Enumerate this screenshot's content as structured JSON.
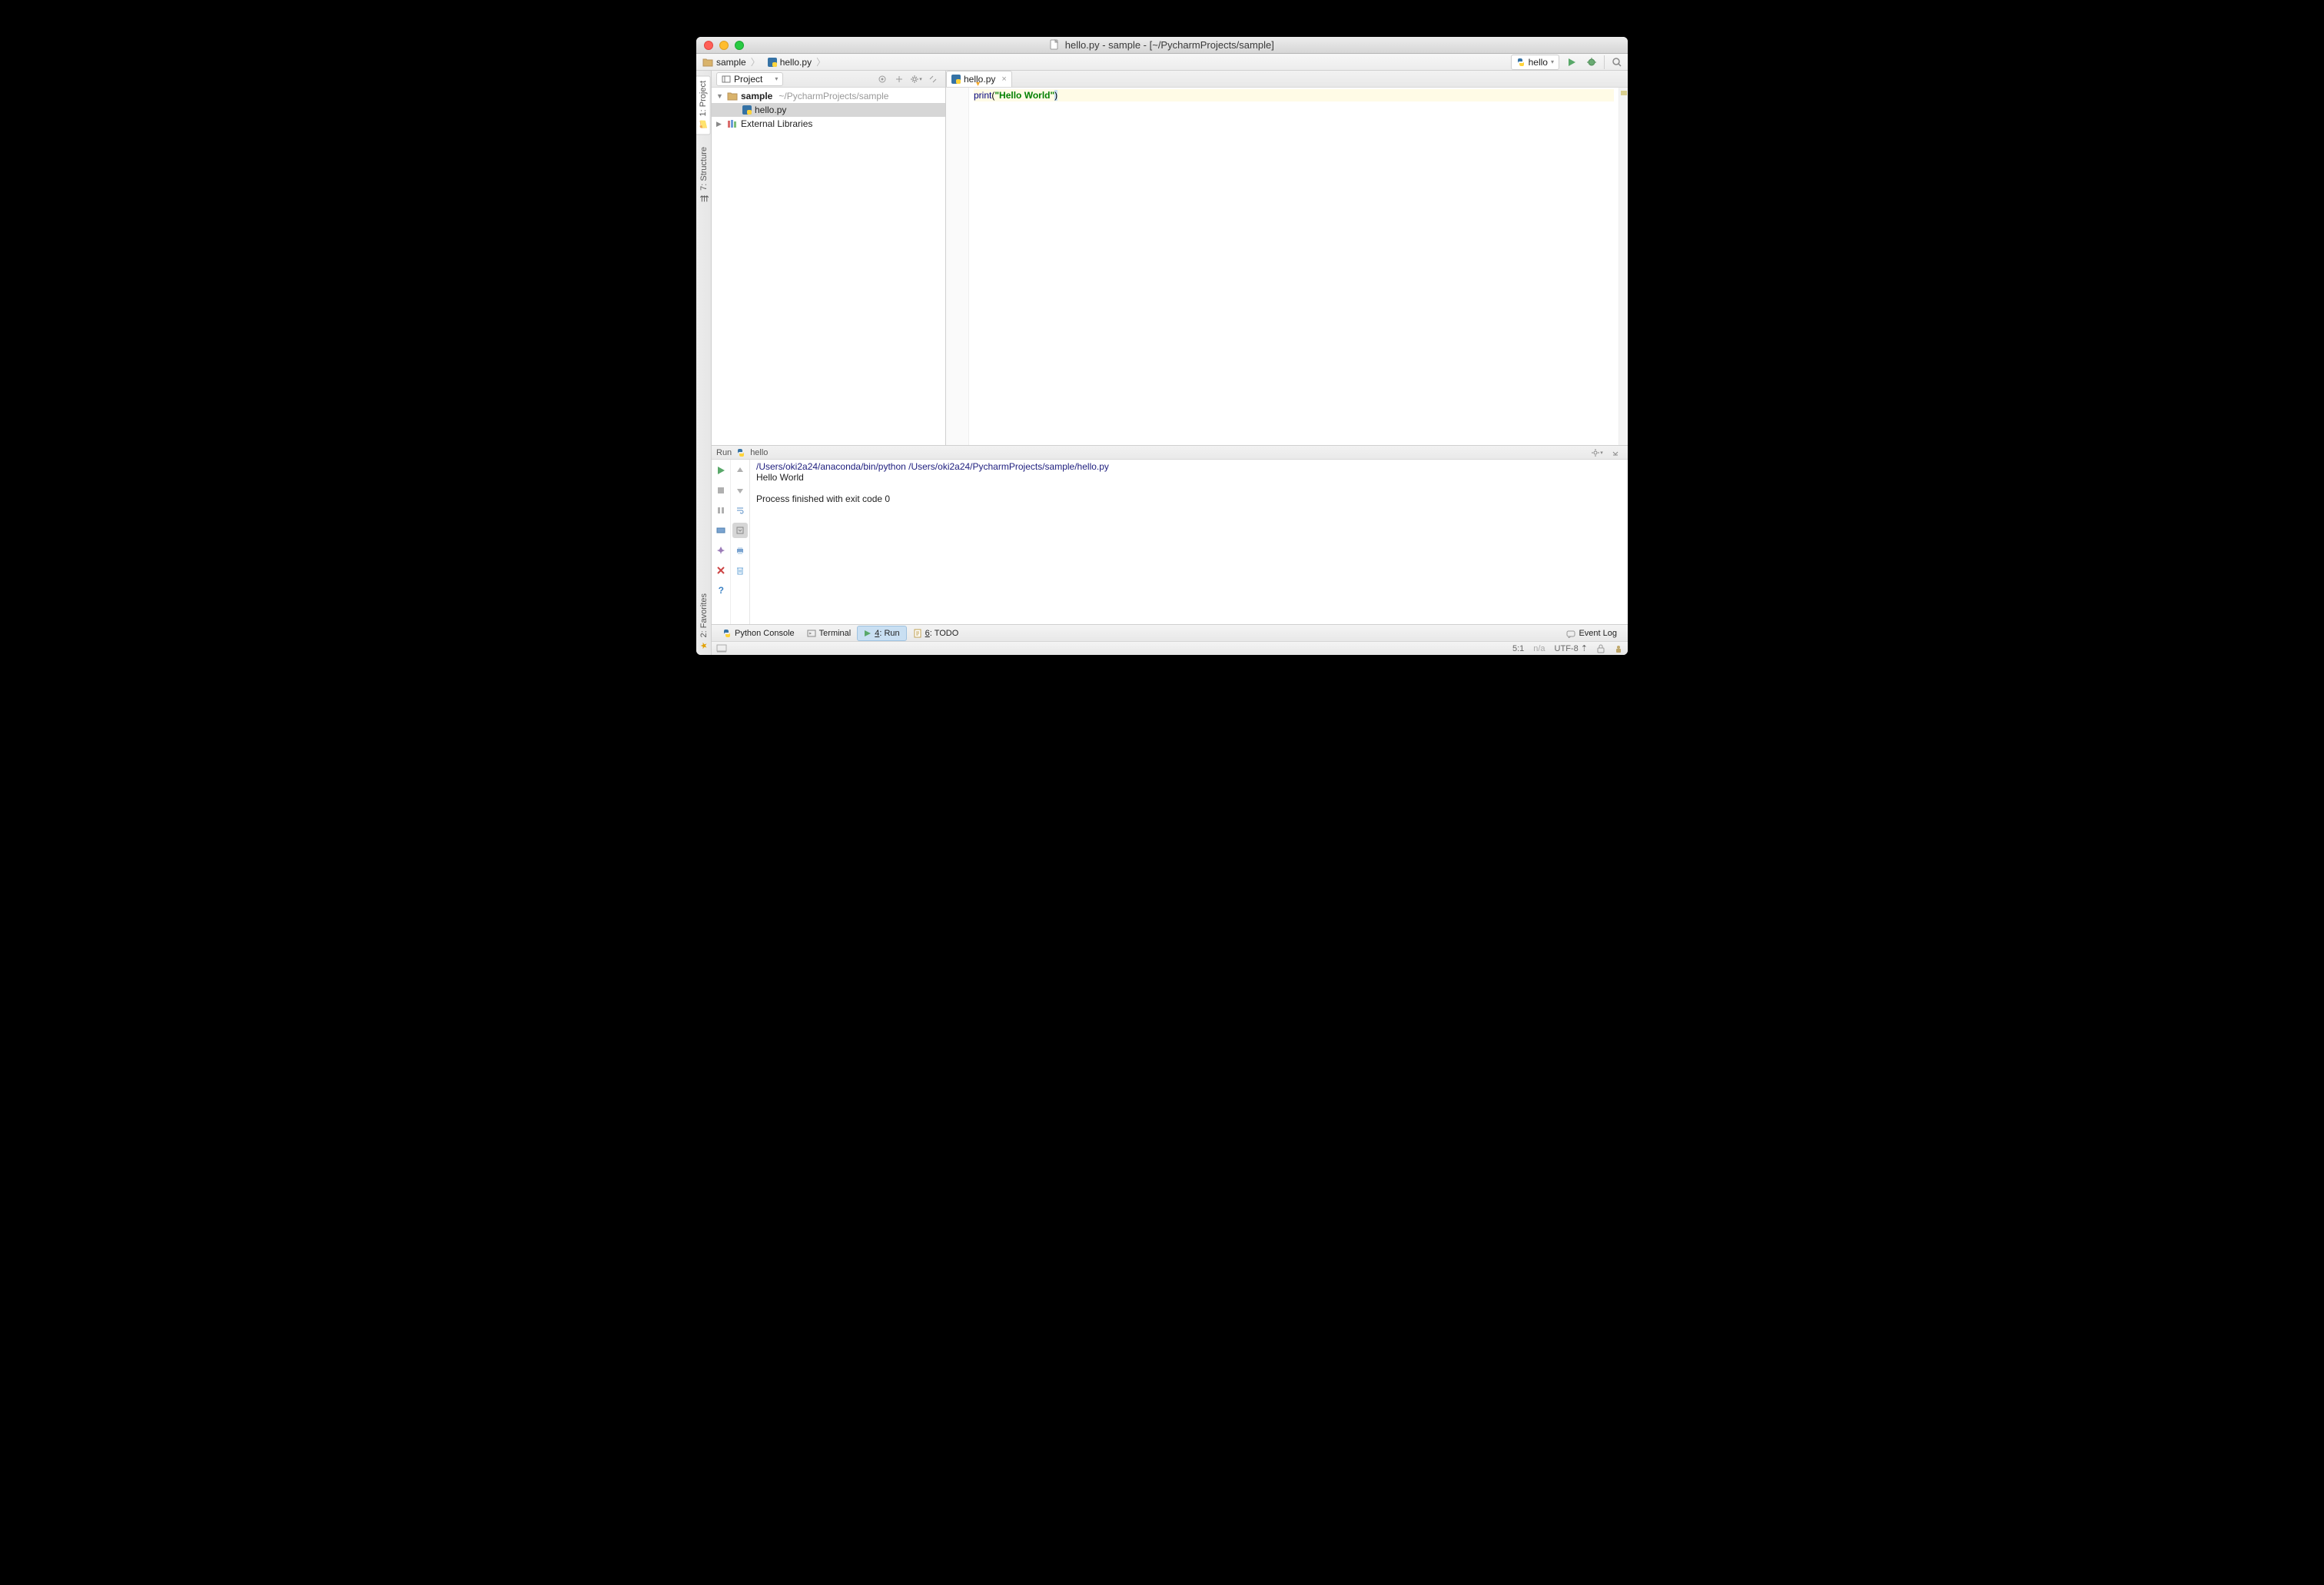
{
  "window": {
    "title": "hello.py - sample - [~/PycharmProjects/sample]"
  },
  "breadcrumbs": [
    {
      "icon": "folder",
      "label": "sample"
    },
    {
      "icon": "pyfile",
      "label": "hello.py"
    }
  ],
  "run_config": {
    "icon": "python",
    "label": "hello"
  },
  "sidebar": {
    "view_label": "Project",
    "tree": {
      "root": {
        "name": "sample",
        "path": "~/PycharmProjects/sample"
      },
      "file": {
        "name": "hello.py"
      },
      "ext": {
        "name": "External Libraries"
      }
    }
  },
  "left_tabs": {
    "project": "1: Project",
    "structure": "7: Structure",
    "favorites": "2: Favorites"
  },
  "editor": {
    "tab": {
      "label": "hello.py"
    },
    "code": {
      "fn": "print",
      "str": "\"Hello World\""
    }
  },
  "run": {
    "header": "Run",
    "config_name": "hello",
    "command_line": "/Users/oki2a24/anaconda/bin/python /Users/oki2a24/PycharmProjects/sample/hello.py",
    "output_line": "Hello World",
    "finished_line": "Process finished with exit code 0"
  },
  "bottom_tabs": {
    "python_console": "Python Console",
    "terminal": "Terminal",
    "run": {
      "prefix": "4",
      "label": ": Run"
    },
    "todo": {
      "prefix": "6",
      "label": ": TODO"
    },
    "event_log": "Event Log"
  },
  "status": {
    "cursor": "5:1",
    "insert": "n/a",
    "encoding": "UTF-8",
    "lock": "⇡"
  }
}
